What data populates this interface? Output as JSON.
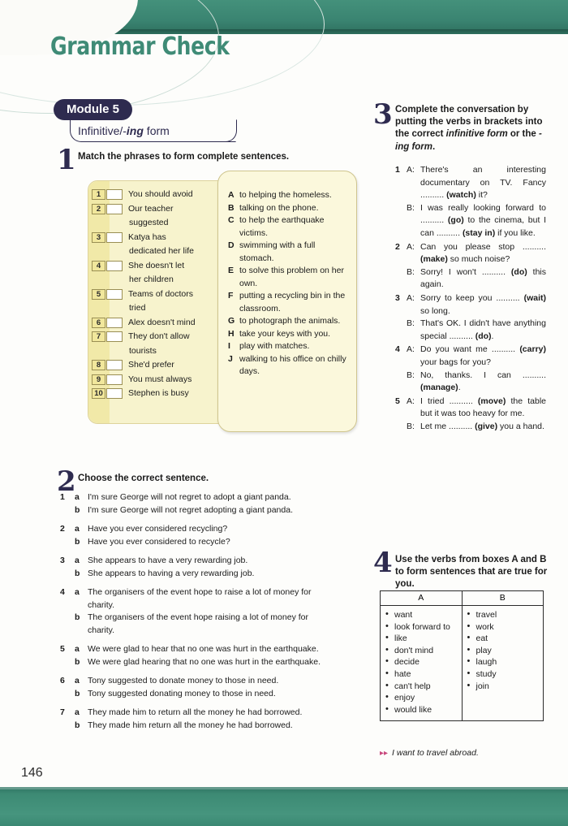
{
  "page": {
    "title": "Grammar Check",
    "page_number": "146",
    "module_badge": "Module 5",
    "module_subtitle_pre": "Infinitive/-",
    "module_subtitle_em": "ing",
    "module_subtitle_post": " form",
    "accent_green": "#3d8a74",
    "badge_navy": "#2e2b4f",
    "box_yellow": "#f7f3cd",
    "example_arrow_color": "#c8487d"
  },
  "ex1": {
    "number": "1",
    "heading": "Match the phrases to form complete sentences.",
    "left_items": [
      {
        "num": "1",
        "text": "You should avoid"
      },
      {
        "num": "2",
        "text": "Our teacher\nsuggested"
      },
      {
        "num": "3",
        "text": "Katya has\ndedicated her life"
      },
      {
        "num": "4",
        "text": "She doesn't let\nher children"
      },
      {
        "num": "5",
        "text": "Teams of doctors\ntried"
      },
      {
        "num": "6",
        "text": "Alex doesn't mind"
      },
      {
        "num": "7",
        "text": "They don't allow\ntourists"
      },
      {
        "num": "8",
        "text": "She'd prefer"
      },
      {
        "num": "9",
        "text": "You must always"
      },
      {
        "num": "10",
        "text": "Stephen is busy"
      }
    ],
    "right_items": [
      {
        "letter": "A",
        "text": "to helping the homeless."
      },
      {
        "letter": "B",
        "text": "talking on the phone."
      },
      {
        "letter": "C",
        "text": "to help the earthquake victims."
      },
      {
        "letter": "D",
        "text": "swimming with a full stomach."
      },
      {
        "letter": "E",
        "text": "to solve this problem on her own."
      },
      {
        "letter": "F",
        "text": "putting a recycling bin in the classroom."
      },
      {
        "letter": "G",
        "text": "to photograph the animals."
      },
      {
        "letter": "H",
        "text": "take your keys with you."
      },
      {
        "letter": "I",
        "text": "play with matches."
      },
      {
        "letter": "J",
        "text": "walking to his office on chilly days."
      }
    ]
  },
  "ex2": {
    "number": "2",
    "heading": "Choose the correct sentence.",
    "questions": [
      {
        "num": "1",
        "a": "I'm sure George will not regret to adopt a giant panda.",
        "b": "I'm sure George will not regret adopting a giant panda."
      },
      {
        "num": "2",
        "a": "Have you ever considered recycling?",
        "b": "Have you ever considered to recycle?"
      },
      {
        "num": "3",
        "a": "She appears to have a very rewarding job.",
        "b": "She appears to having a very rewarding job."
      },
      {
        "num": "4",
        "a": "The organisers of the event hope to raise a lot of money for charity.",
        "b": "The organisers of the event hope raising a lot of money for charity."
      },
      {
        "num": "5",
        "a": "We were glad to hear that no one was hurt in the earthquake.",
        "b": "We were glad hearing that no one was hurt in the earthquake."
      },
      {
        "num": "6",
        "a": "Tony suggested to donate money to those in need.",
        "b": "Tony suggested donating money to those in need."
      },
      {
        "num": "7",
        "a": "They made him to return all the money he had borrowed.",
        "b": "They made him return all the money he had borrowed."
      }
    ]
  },
  "ex3": {
    "number": "3",
    "heading_part1": "Complete the conversation by putting the verbs in brackets into the correct ",
    "heading_em1": "infinitive form",
    "heading_part2": " or the ",
    "heading_em2": "-ing form",
    "heading_part3": ".",
    "items": [
      {
        "num": "1",
        "lines": [
          {
            "speaker": "A:",
            "text": "There's an interesting documentary on TV. Fancy .......... (watch) it?"
          },
          {
            "speaker": "B:",
            "text": "I was really looking forward to .......... (go) to the cinema, but I can .......... (stay in) if you like."
          }
        ]
      },
      {
        "num": "2",
        "lines": [
          {
            "speaker": "A:",
            "text": "Can you please stop .......... (make) so much noise?"
          },
          {
            "speaker": "B:",
            "text": "Sorry! I won't .......... (do) this again."
          }
        ]
      },
      {
        "num": "3",
        "lines": [
          {
            "speaker": "A:",
            "text": "Sorry to keep you .......... (wait) so long."
          },
          {
            "speaker": "B:",
            "text": "That's OK. I didn't have anything special .......... (do)."
          }
        ]
      },
      {
        "num": "4",
        "lines": [
          {
            "speaker": "A:",
            "text": "Do you want me .......... (carry) your bags for you?"
          },
          {
            "speaker": "B:",
            "text": "No, thanks. I can .......... (manage)."
          }
        ]
      },
      {
        "num": "5",
        "lines": [
          {
            "speaker": "A:",
            "text": "I tried .......... (move) the table but it was too heavy for me."
          },
          {
            "speaker": "B:",
            "text": "Let me .......... (give) you a hand."
          }
        ]
      }
    ]
  },
  "ex4": {
    "number": "4",
    "heading": "Use the verbs from boxes A and B to form sentences that are true for you.",
    "col_a_header": "A",
    "col_b_header": "B",
    "col_a": [
      "want",
      "look forward to",
      "like",
      "don't mind",
      "decide",
      "hate",
      "can't help",
      "enjoy",
      "would like"
    ],
    "col_b": [
      "travel",
      "work",
      "eat",
      "play",
      "laugh",
      "study",
      "join"
    ],
    "example": "I want to travel abroad."
  }
}
